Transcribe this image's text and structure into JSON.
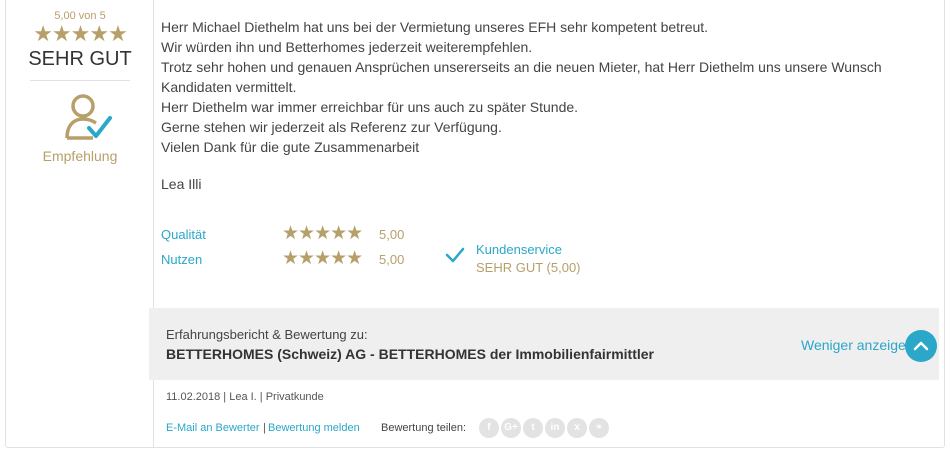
{
  "summary": {
    "score_label": "5,00 von 5",
    "stars": "★★★★★",
    "grade": "SEHR GUT",
    "recommendation": "Empfehlung"
  },
  "review": {
    "lines": [
      "Herr Michael Diethelm hat uns bei der Vermietung unseres EFH sehr kompetent betreut.",
      "Wir würden ihn und Betterhomes jederzeit weiterempfehlen.",
      "Trotz sehr hohen und genauen Ansprüchen unsererseits an die neuen Mieter, hat Herr Diethelm uns unsere Wunsch Kandidaten vermittelt.",
      "Herr Diethelm war immer erreichbar für uns auch zu später Stunde.",
      "Gerne stehen wir jederzeit als Referenz zur Verfügung.",
      "Vielen Dank für die gute Zusammenarbeit"
    ],
    "author": "Lea Illi"
  },
  "ratings": [
    {
      "label": "Qualität",
      "stars": "★★★★★",
      "value": "5,00"
    },
    {
      "label": "Nutzen",
      "stars": "★★★★★",
      "value": "5,00"
    }
  ],
  "service": {
    "title": "Kundenservice",
    "value": "SEHR GUT (5,00)"
  },
  "subject": {
    "prefix": "Erfahrungsbericht & Bewertung zu:",
    "name": "BETTERHOMES (Schweiz) AG - BETTERHOMES der Immobilienfairmittler",
    "toggle_label": "Weniger anzeigen"
  },
  "meta": "11.02.2018 | Lea I. | Privatkunde",
  "footer": {
    "email_link": "E-Mail an Bewerter",
    "separator": "|",
    "report_link": "Bewertung melden",
    "share_label": "Bewertung teilen:",
    "share_icons": [
      {
        "name": "facebook-icon",
        "glyph": "f"
      },
      {
        "name": "google-plus-icon",
        "glyph": "G+"
      },
      {
        "name": "twitter-icon",
        "glyph": "t"
      },
      {
        "name": "linkedin-icon",
        "glyph": "in"
      },
      {
        "name": "xing-icon",
        "glyph": "x"
      },
      {
        "name": "link-icon",
        "glyph": "⚭"
      }
    ]
  },
  "colors": {
    "gold": "#b79f6a",
    "accent_blue": "#2aa7c9",
    "band_gray": "#efefef"
  }
}
